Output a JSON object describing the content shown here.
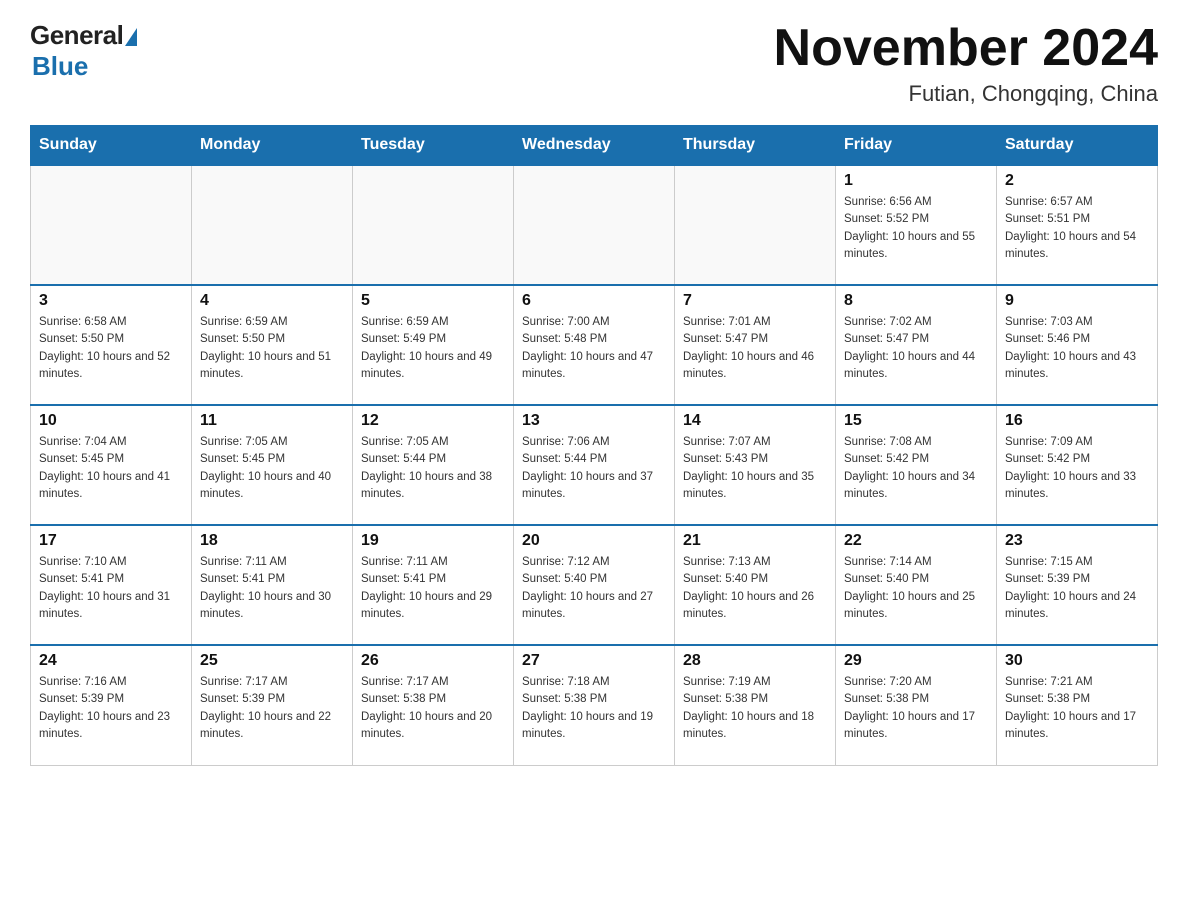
{
  "header": {
    "logo_general": "General",
    "logo_blue": "Blue",
    "month_title": "November 2024",
    "location": "Futian, Chongqing, China"
  },
  "weekdays": [
    "Sunday",
    "Monday",
    "Tuesday",
    "Wednesday",
    "Thursday",
    "Friday",
    "Saturday"
  ],
  "rows": [
    [
      {
        "day": "",
        "sunrise": "",
        "sunset": "",
        "daylight": ""
      },
      {
        "day": "",
        "sunrise": "",
        "sunset": "",
        "daylight": ""
      },
      {
        "day": "",
        "sunrise": "",
        "sunset": "",
        "daylight": ""
      },
      {
        "day": "",
        "sunrise": "",
        "sunset": "",
        "daylight": ""
      },
      {
        "day": "",
        "sunrise": "",
        "sunset": "",
        "daylight": ""
      },
      {
        "day": "1",
        "sunrise": "Sunrise: 6:56 AM",
        "sunset": "Sunset: 5:52 PM",
        "daylight": "Daylight: 10 hours and 55 minutes."
      },
      {
        "day": "2",
        "sunrise": "Sunrise: 6:57 AM",
        "sunset": "Sunset: 5:51 PM",
        "daylight": "Daylight: 10 hours and 54 minutes."
      }
    ],
    [
      {
        "day": "3",
        "sunrise": "Sunrise: 6:58 AM",
        "sunset": "Sunset: 5:50 PM",
        "daylight": "Daylight: 10 hours and 52 minutes."
      },
      {
        "day": "4",
        "sunrise": "Sunrise: 6:59 AM",
        "sunset": "Sunset: 5:50 PM",
        "daylight": "Daylight: 10 hours and 51 minutes."
      },
      {
        "day": "5",
        "sunrise": "Sunrise: 6:59 AM",
        "sunset": "Sunset: 5:49 PM",
        "daylight": "Daylight: 10 hours and 49 minutes."
      },
      {
        "day": "6",
        "sunrise": "Sunrise: 7:00 AM",
        "sunset": "Sunset: 5:48 PM",
        "daylight": "Daylight: 10 hours and 47 minutes."
      },
      {
        "day": "7",
        "sunrise": "Sunrise: 7:01 AM",
        "sunset": "Sunset: 5:47 PM",
        "daylight": "Daylight: 10 hours and 46 minutes."
      },
      {
        "day": "8",
        "sunrise": "Sunrise: 7:02 AM",
        "sunset": "Sunset: 5:47 PM",
        "daylight": "Daylight: 10 hours and 44 minutes."
      },
      {
        "day": "9",
        "sunrise": "Sunrise: 7:03 AM",
        "sunset": "Sunset: 5:46 PM",
        "daylight": "Daylight: 10 hours and 43 minutes."
      }
    ],
    [
      {
        "day": "10",
        "sunrise": "Sunrise: 7:04 AM",
        "sunset": "Sunset: 5:45 PM",
        "daylight": "Daylight: 10 hours and 41 minutes."
      },
      {
        "day": "11",
        "sunrise": "Sunrise: 7:05 AM",
        "sunset": "Sunset: 5:45 PM",
        "daylight": "Daylight: 10 hours and 40 minutes."
      },
      {
        "day": "12",
        "sunrise": "Sunrise: 7:05 AM",
        "sunset": "Sunset: 5:44 PM",
        "daylight": "Daylight: 10 hours and 38 minutes."
      },
      {
        "day": "13",
        "sunrise": "Sunrise: 7:06 AM",
        "sunset": "Sunset: 5:44 PM",
        "daylight": "Daylight: 10 hours and 37 minutes."
      },
      {
        "day": "14",
        "sunrise": "Sunrise: 7:07 AM",
        "sunset": "Sunset: 5:43 PM",
        "daylight": "Daylight: 10 hours and 35 minutes."
      },
      {
        "day": "15",
        "sunrise": "Sunrise: 7:08 AM",
        "sunset": "Sunset: 5:42 PM",
        "daylight": "Daylight: 10 hours and 34 minutes."
      },
      {
        "day": "16",
        "sunrise": "Sunrise: 7:09 AM",
        "sunset": "Sunset: 5:42 PM",
        "daylight": "Daylight: 10 hours and 33 minutes."
      }
    ],
    [
      {
        "day": "17",
        "sunrise": "Sunrise: 7:10 AM",
        "sunset": "Sunset: 5:41 PM",
        "daylight": "Daylight: 10 hours and 31 minutes."
      },
      {
        "day": "18",
        "sunrise": "Sunrise: 7:11 AM",
        "sunset": "Sunset: 5:41 PM",
        "daylight": "Daylight: 10 hours and 30 minutes."
      },
      {
        "day": "19",
        "sunrise": "Sunrise: 7:11 AM",
        "sunset": "Sunset: 5:41 PM",
        "daylight": "Daylight: 10 hours and 29 minutes."
      },
      {
        "day": "20",
        "sunrise": "Sunrise: 7:12 AM",
        "sunset": "Sunset: 5:40 PM",
        "daylight": "Daylight: 10 hours and 27 minutes."
      },
      {
        "day": "21",
        "sunrise": "Sunrise: 7:13 AM",
        "sunset": "Sunset: 5:40 PM",
        "daylight": "Daylight: 10 hours and 26 minutes."
      },
      {
        "day": "22",
        "sunrise": "Sunrise: 7:14 AM",
        "sunset": "Sunset: 5:40 PM",
        "daylight": "Daylight: 10 hours and 25 minutes."
      },
      {
        "day": "23",
        "sunrise": "Sunrise: 7:15 AM",
        "sunset": "Sunset: 5:39 PM",
        "daylight": "Daylight: 10 hours and 24 minutes."
      }
    ],
    [
      {
        "day": "24",
        "sunrise": "Sunrise: 7:16 AM",
        "sunset": "Sunset: 5:39 PM",
        "daylight": "Daylight: 10 hours and 23 minutes."
      },
      {
        "day": "25",
        "sunrise": "Sunrise: 7:17 AM",
        "sunset": "Sunset: 5:39 PM",
        "daylight": "Daylight: 10 hours and 22 minutes."
      },
      {
        "day": "26",
        "sunrise": "Sunrise: 7:17 AM",
        "sunset": "Sunset: 5:38 PM",
        "daylight": "Daylight: 10 hours and 20 minutes."
      },
      {
        "day": "27",
        "sunrise": "Sunrise: 7:18 AM",
        "sunset": "Sunset: 5:38 PM",
        "daylight": "Daylight: 10 hours and 19 minutes."
      },
      {
        "day": "28",
        "sunrise": "Sunrise: 7:19 AM",
        "sunset": "Sunset: 5:38 PM",
        "daylight": "Daylight: 10 hours and 18 minutes."
      },
      {
        "day": "29",
        "sunrise": "Sunrise: 7:20 AM",
        "sunset": "Sunset: 5:38 PM",
        "daylight": "Daylight: 10 hours and 17 minutes."
      },
      {
        "day": "30",
        "sunrise": "Sunrise: 7:21 AM",
        "sunset": "Sunset: 5:38 PM",
        "daylight": "Daylight: 10 hours and 17 minutes."
      }
    ]
  ]
}
